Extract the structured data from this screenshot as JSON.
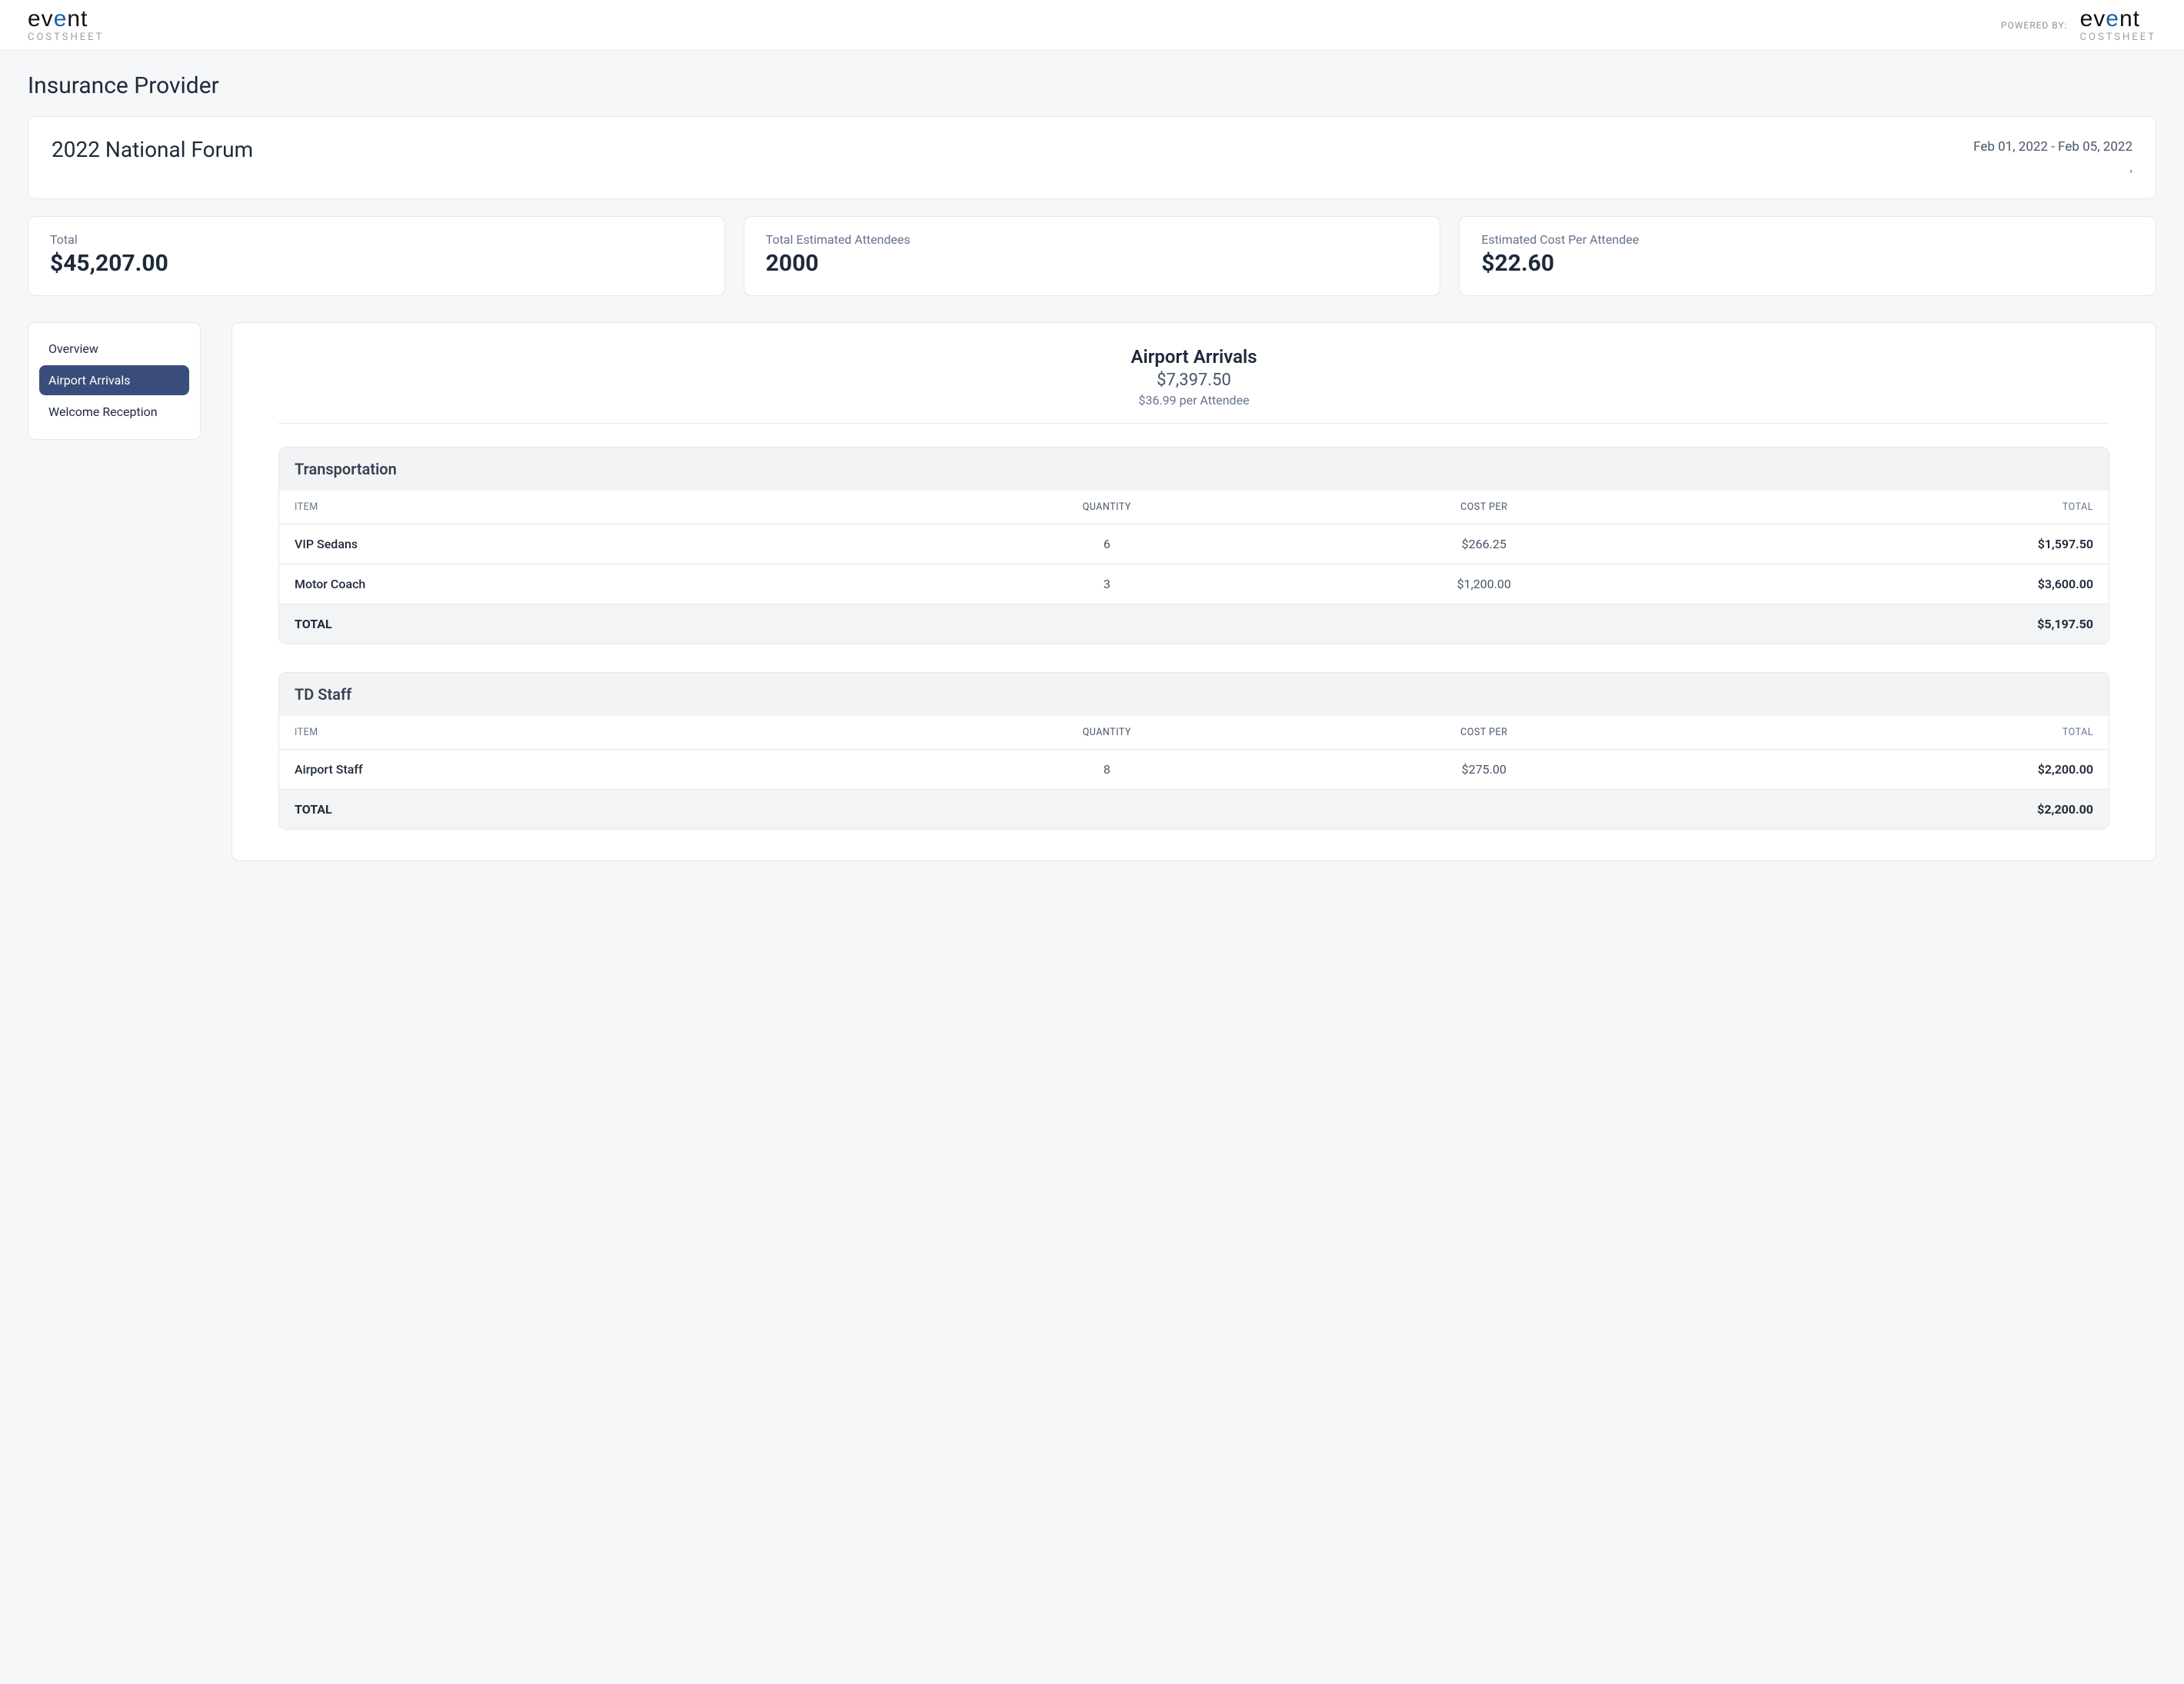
{
  "header": {
    "powered_by_label": "POWERED BY:",
    "logo_main": "event",
    "logo_sub": "COSTSHEET"
  },
  "page_title": "Insurance Provider",
  "event": {
    "name": "2022 National Forum",
    "date_range": "Feb 01, 2022 - Feb 05, 2022",
    "location": ","
  },
  "stats": {
    "total": {
      "label": "Total",
      "value": "$45,207.00"
    },
    "attendees": {
      "label": "Total Estimated Attendees",
      "value": "2000"
    },
    "per": {
      "label": "Estimated Cost Per Attendee",
      "value": "$22.60"
    }
  },
  "sidebar": {
    "items": [
      {
        "label": "Overview",
        "active": false
      },
      {
        "label": "Airport Arrivals",
        "active": true
      },
      {
        "label": "Welcome Reception",
        "active": false
      }
    ]
  },
  "section": {
    "title": "Airport Arrivals",
    "amount": "$7,397.50",
    "per_attendee": "$36.99 per Attendee"
  },
  "table_headers": {
    "item": "ITEM",
    "quantity": "QUANTITY",
    "cost_per": "COST PER",
    "total": "TOTAL",
    "total_row_label": "TOTAL"
  },
  "categories": [
    {
      "name": "Transportation",
      "rows": [
        {
          "item": "VIP Sedans",
          "qty": "6",
          "cost_per": "$266.25",
          "total": "$1,597.50"
        },
        {
          "item": "Motor Coach",
          "qty": "3",
          "cost_per": "$1,200.00",
          "total": "$3,600.00"
        }
      ],
      "total": "$5,197.50"
    },
    {
      "name": "TD Staff",
      "rows": [
        {
          "item": "Airport Staff",
          "qty": "8",
          "cost_per": "$275.00",
          "total": "$2,200.00"
        }
      ],
      "total": "$2,200.00"
    }
  ]
}
